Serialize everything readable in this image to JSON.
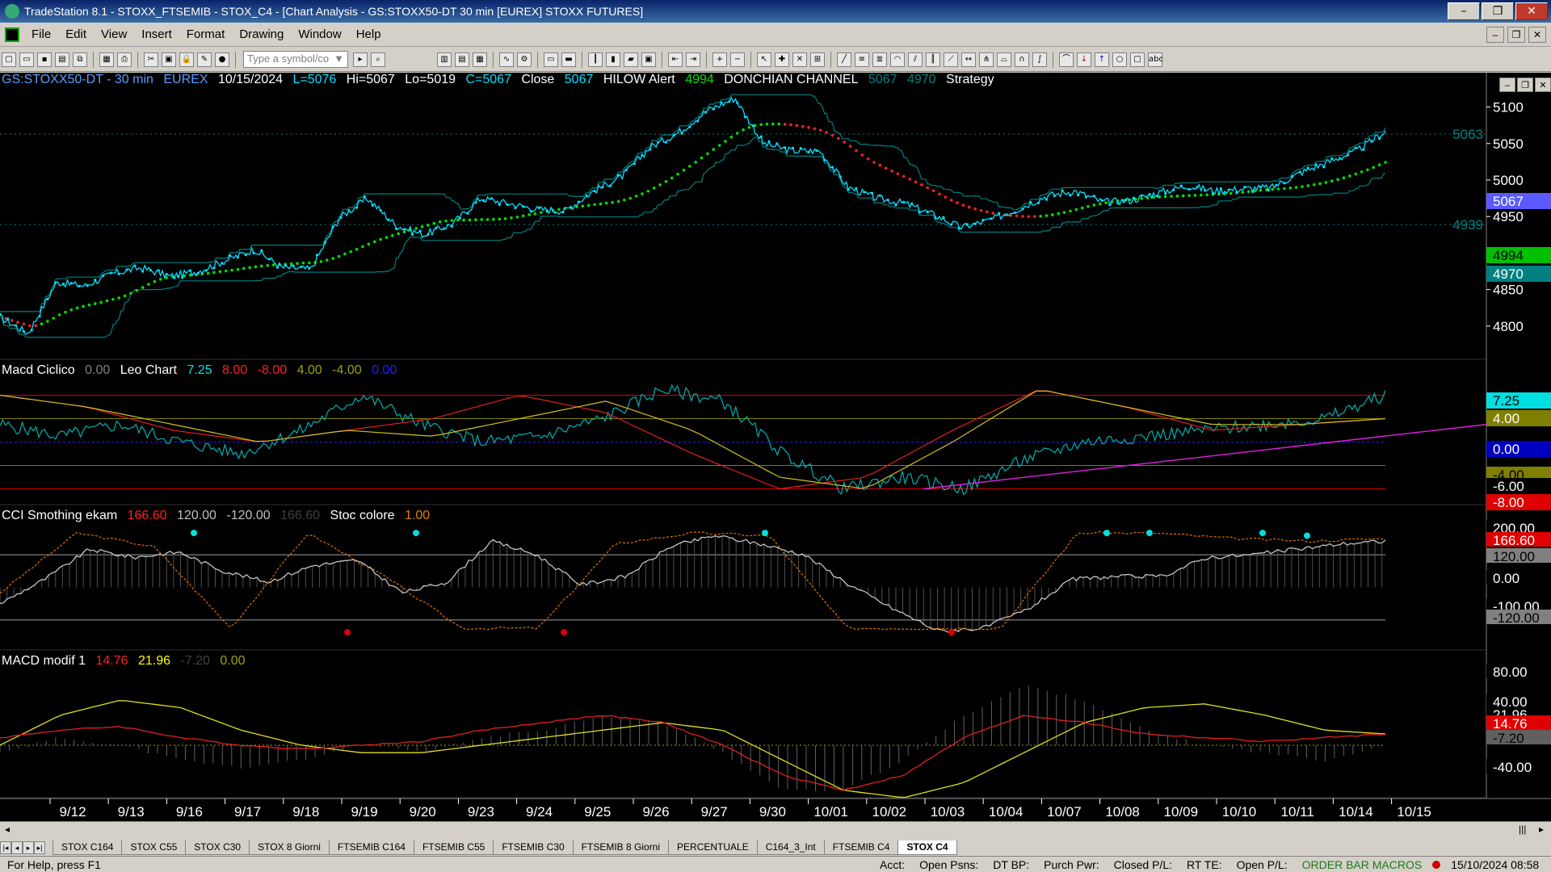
{
  "window": {
    "title": "TradeStation 8.1 - STOXX_FTSEMIB - STOX_C4 - [Chart Analysis - GS:STOXX50-DT  30 min  [EUREX] STOXX FUTURES]"
  },
  "menu": [
    "File",
    "Edit",
    "View",
    "Insert",
    "Format",
    "Drawing",
    "Window",
    "Help"
  ],
  "toolbar": {
    "symbol_placeholder": "Type a symbol/co"
  },
  "main_legend": {
    "symbol": "GS:STOXX50-DT - 30 min",
    "exchange": "EUREX",
    "date": "10/15/2024",
    "last": "L=5076",
    "high": "Hi=5067",
    "low": "Lo=5019",
    "close": "C=5067",
    "close_label": "Close",
    "close_val": "5067",
    "hilow": "HILOW Alert",
    "hilow_val": "4994",
    "donchian": "DONCHIAN CHANNEL",
    "don_hi": "5067",
    "don_lo": "4970",
    "strategy": "Strategy"
  },
  "macd_ciclico_legend": {
    "name": "Macd Ciclico",
    "v0": "0.00",
    "leo": "Leo Chart",
    "v1": "7.25",
    "v2": "8.00",
    "v3": "-8.00",
    "v4": "4.00",
    "v5": "-4.00",
    "v6": "0.00"
  },
  "cci_legend": {
    "name": "CCI Smothing ekam",
    "v1": "166.60",
    "v2": "120.00",
    "v3": "-120.00",
    "v4": "166.60",
    "stoc": "Stoc colore",
    "v5": "1.00"
  },
  "macd_modif_legend": {
    "name": "MACD modif 1",
    "v1": "14.76",
    "v2": "21.96",
    "v3": "-7.20",
    "v4": "0.00"
  },
  "price_axis": {
    "ticks": [
      "5100",
      "5050",
      "5000",
      "4950",
      "4900",
      "4850",
      "4800"
    ],
    "markers": [
      {
        "label": "5067",
        "bg": "#5a5aff",
        "fg": "#fff"
      },
      {
        "label": "4994",
        "bg": "#00c000",
        "fg": "#000"
      },
      {
        "label": "4970",
        "bg": "#008080",
        "fg": "#fff"
      }
    ],
    "left_labels": [
      "5063",
      "4939"
    ]
  },
  "macd_axis": {
    "markers": [
      {
        "label": "7.25",
        "bg": "#00e0e0",
        "fg": "#000"
      },
      {
        "label": "4.00",
        "bg": "#808000",
        "fg": "#fff"
      },
      {
        "label": "0.00",
        "bg": "#0000c0",
        "fg": "#fff"
      },
      {
        "label": "-4.00",
        "bg": "#808000",
        "fg": "#000"
      },
      {
        "label": "-6.00",
        "bg": "#000",
        "fg": "#fff"
      },
      {
        "label": "-8.00",
        "bg": "#e00000",
        "fg": "#fff"
      }
    ]
  },
  "cci_axis": {
    "markers": [
      {
        "label": "200.00",
        "bg": "#000",
        "fg": "#fff"
      },
      {
        "label": "166.60",
        "bg": "#e00000",
        "fg": "#fff"
      },
      {
        "label": "120.00",
        "bg": "#808080",
        "fg": "#000"
      },
      {
        "label": "0.00",
        "bg": "#000",
        "fg": "#fff"
      },
      {
        "label": "-100.00",
        "bg": "#000",
        "fg": "#fff"
      },
      {
        "label": "-120.00",
        "bg": "#808080",
        "fg": "#000"
      }
    ]
  },
  "macd2_axis": {
    "markers": [
      {
        "label": "80.00",
        "bg": "#000",
        "fg": "#fff"
      },
      {
        "label": "40.00",
        "bg": "#000",
        "fg": "#fff"
      },
      {
        "label": "21.96",
        "bg": "#000",
        "fg": "#fff"
      },
      {
        "label": "14.76",
        "bg": "#e00000",
        "fg": "#fff"
      },
      {
        "label": "-7.20",
        "bg": "#606060",
        "fg": "#000"
      },
      {
        "label": "-40.00",
        "bg": "#000",
        "fg": "#fff"
      }
    ]
  },
  "date_axis": [
    "9/12",
    "9/13",
    "9/16",
    "9/17",
    "9/18",
    "9/19",
    "9/20",
    "9/23",
    "9/24",
    "9/25",
    "9/26",
    "9/27",
    "9/30",
    "10/01",
    "10/02",
    "10/03",
    "10/04",
    "10/07",
    "10/08",
    "10/09",
    "10/10",
    "10/11",
    "10/14",
    "10/15"
  ],
  "tabs": [
    "STOX C164",
    "STOX C55",
    "STOX  C30",
    "STOX  8 Giorni",
    "FTSEMIB C164",
    "FTSEMIB C55",
    "FTSEMIB C30",
    "FTSEMIB  8 Giorni",
    "PERCENTUALE",
    "C164_3_Int",
    "FTSEMIB C4",
    "STOX  C4"
  ],
  "active_tab": "STOX  C4",
  "status": {
    "help": "For Help, press F1",
    "acct": "Acct:",
    "open_psns": "Open Psns:",
    "dt_bp": "DT BP:",
    "purch_pwr": "Purch Pwr:",
    "closed_pl": "Closed P/L:",
    "rt_te": "RT TE:",
    "open_pl": "Open P/L:",
    "macros": "ORDER BAR  MACROS",
    "datetime": "15/10/2024 08:58"
  },
  "chart_data": {
    "type": "line",
    "price_range": [
      4760,
      5125
    ],
    "price_series_points": [
      4812,
      4790,
      4860,
      4855,
      4872,
      4880,
      4868,
      4875,
      4890,
      4905,
      4880,
      4878,
      4948,
      4975,
      4938,
      4925,
      4940,
      4975,
      4968,
      4960,
      4958,
      4985,
      5005,
      5045,
      5065,
      5095,
      5112,
      5050,
      5040,
      5040,
      4990,
      4975,
      4968,
      4953,
      4935,
      4945,
      4960,
      4978,
      4985,
      4970,
      4972,
      4983,
      4992,
      4985,
      4988,
      4990,
      5010,
      5025,
      5040,
      5067
    ],
    "colors": {
      "price": "#00e0ff",
      "donchian": "#008080",
      "ma_up": "#00e000",
      "ma_down": "#ff2020"
    }
  }
}
